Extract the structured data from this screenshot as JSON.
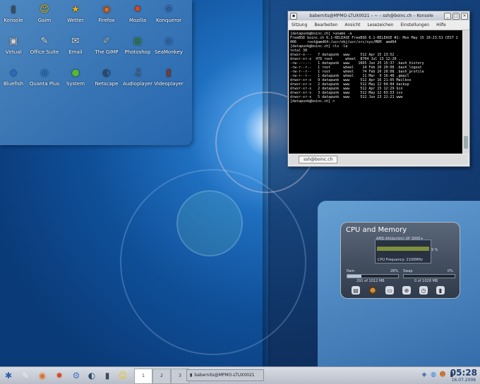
{
  "desktop_icons": [
    {
      "label": "Konsole",
      "icon": "terminal-icon",
      "glyph": "▮",
      "color": "#3b4b5c"
    },
    {
      "label": "Gaim",
      "icon": "gaim-icon",
      "glyph": "☺",
      "color": "#f2c200"
    },
    {
      "label": "Wetter",
      "icon": "weather-icon",
      "glyph": "★",
      "color": "#f1b500"
    },
    {
      "label": "Firefox",
      "icon": "firefox-icon",
      "glyph": "◉",
      "color": "#e36b1e"
    },
    {
      "label": "Mozilla",
      "icon": "mozilla-icon",
      "glyph": "✹",
      "color": "#d9481e"
    },
    {
      "label": "Konqueror",
      "icon": "konqueror-icon",
      "glyph": "⚙",
      "color": "#4575c9"
    },
    {
      "label": "Virtual",
      "icon": "virtual-icon",
      "glyph": "▣",
      "color": "#c9ccd1"
    },
    {
      "label": "Office Suite",
      "icon": "office-icon",
      "glyph": "✎",
      "color": "#e4e8ee"
    },
    {
      "label": "Email",
      "icon": "email-icon",
      "glyph": "✉",
      "color": "#dfe5ee"
    },
    {
      "label": "The GIMP",
      "icon": "gimp-icon",
      "glyph": "✐",
      "color": "#b8c0c9"
    },
    {
      "label": "Photoshop",
      "icon": "photo-icon",
      "glyph": "▤",
      "color": "#3f9c52"
    },
    {
      "label": "SeaMonkey",
      "icon": "seamonkey-icon",
      "glyph": "◍",
      "color": "#3d86d6"
    },
    {
      "label": "Bluefish",
      "icon": "bluefish-icon",
      "glyph": "◆",
      "color": "#2d6dbf"
    },
    {
      "label": "Quanta Plus",
      "icon": "quanta-icon",
      "glyph": "◎",
      "color": "#2c7de0"
    },
    {
      "label": "System",
      "icon": "system-icon",
      "glyph": "●",
      "color": "#58b82e"
    },
    {
      "label": "Netscape",
      "icon": "netscape-icon",
      "glyph": "◐",
      "color": "#2a4a66"
    },
    {
      "label": "Audioplayer",
      "icon": "audio-icon",
      "glyph": "♫",
      "color": "#5c6470"
    },
    {
      "label": "Videoplayer",
      "icon": "video-icon",
      "glyph": "▮",
      "color": "#7a3b2e"
    }
  ],
  "konsole": {
    "title": "babernits@MPMO-LTUX0021 – ~ – ssh@boinc.ch – Konsole",
    "menu": [
      "Sitzung",
      "Bearbeiten",
      "Ansicht",
      "Lesezeichen",
      "Einstellungen",
      "Hilfe"
    ],
    "lines": [
      "[datapunk@boinc.ch] >uname -a",
      "FreeBSD boinc.ch 6.1-RELEASE FreeBSD 6.1-RELEASE #1: Mon May 15 10:23:51 CEST 2",
      "006     root@amd64:/usr/obj/usr/src/sys/MDM  amd64",
      "[datapunk@boinc.ch] >ls -la",
      "total 30",
      "drwxr-x---   7 datapunk  www     512 Apr 15 23:52 .",
      "drwxr-xr-x  476 root      wheel  8704 Jul 13 12:20 ..",
      "-rw-------   1 datapunk  www    1665 Jun 25 15:37 .bash_history",
      "-rw-r--r--   1 root      wheel    14 Feb 20 20:08 .bash_logout",
      "-rw-r--r--   1 root      wheel    74 Feb 20 20:08 .bash_profile",
      "-rw-r--r--   1 datapunk  wheel    11 Mar  9 16:48 .gmail",
      "drwxr-xr-x   9 datapunk  www     512 Apr 16 21:05 Mailbox",
      "drwxr-xr-x   2 datapunk  www     512 May 22 04:04 backup",
      "drwxr-xr-x   2 datapunk  www     512 Apr 15 12:29 bin",
      "drwxr-xr-x   3 datapunk  www     512 May 22 03:53 cvs",
      "drwxr-xr-x   5 datapunk  www     512 Jun 23 22:21 www",
      "[datapunk@boinc.ch] >"
    ],
    "tab": "ssh@boinc.ch"
  },
  "cpu_widget": {
    "title": "CPU and Memory",
    "processor": "AMD Athlon(tm) XP 3000+",
    "cpu_percent": "9 %",
    "cpu_freq": "CPU Frequency: 2100MHz",
    "ram_label": "Ram",
    "ram_percent": "28%",
    "ram_fill": 0.28,
    "ram_detail": "291 of 1012 MB",
    "swap_label": "Swap",
    "swap_percent": "0%",
    "swap_fill": 0,
    "swap_detail": "0 of 1028 MB",
    "icons": [
      "drive-icon",
      "smile-icon",
      "hdd-icon",
      "network-icon",
      "clock-icon",
      "battery-icon"
    ]
  },
  "taskbar": {
    "pager": [
      "1",
      "2",
      "3"
    ],
    "task_label": "babernits@MPMO-LTUX0021",
    "time": "05:28",
    "date": "16.07.2006"
  }
}
